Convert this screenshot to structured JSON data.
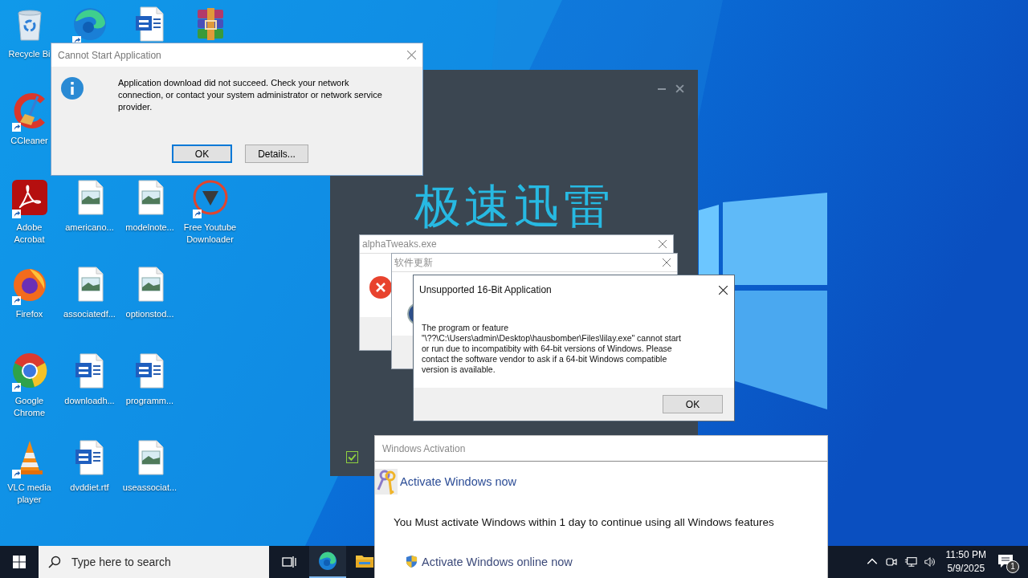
{
  "desktop_icons": [
    [
      {
        "kind": "recycle",
        "label": "Recycle Bi",
        "shortcut": false
      },
      {
        "kind": "edge",
        "shortcut": true
      },
      {
        "kind": "word",
        "shortcut": false
      },
      {
        "kind": "winrar",
        "shortcut": false
      }
    ],
    [
      {
        "kind": "ccleaner",
        "label": "CCleaner",
        "shortcut": true
      }
    ],
    [
      {
        "kind": "acrobat",
        "label": "Adobe Acrobat",
        "shortcut": true
      },
      {
        "kind": "image",
        "label": "americano...",
        "shortcut": false
      },
      {
        "kind": "image",
        "label": "modelnote...",
        "shortcut": false
      },
      {
        "kind": "ytdownloader",
        "label": "Free Youtube Downloader",
        "shortcut": true
      }
    ],
    [
      {
        "kind": "firefox",
        "label": "Firefox",
        "shortcut": true
      },
      {
        "kind": "image",
        "label": "associatedf...",
        "shortcut": false
      },
      {
        "kind": "image",
        "label": "optionstod...",
        "shortcut": false
      }
    ],
    [
      {
        "kind": "chrome",
        "label": "Google Chrome",
        "shortcut": true
      },
      {
        "kind": "word",
        "label": "downloadh...",
        "shortcut": false
      },
      {
        "kind": "word",
        "label": "programm...",
        "shortcut": false
      }
    ],
    [
      {
        "kind": "vlc",
        "label": "VLC media player",
        "shortcut": true
      },
      {
        "kind": "word",
        "label": "dvddiet.rtf",
        "shortcut": false
      },
      {
        "kind": "image",
        "label": "useassociat...",
        "shortcut": false
      }
    ]
  ],
  "xunlei_window": {
    "logo_text": "极速迅雷",
    "checkbox": {
      "checked": true
    }
  },
  "alpha_dialog": {
    "title": "alphaTweaks.exe"
  },
  "update_dialog": {
    "title": "软件更新"
  },
  "unsupported_dialog": {
    "title": "Unsupported 16-Bit Application",
    "message_lines": [
      "The program or feature",
      "\"\\??\\C:\\Users\\admin\\Desktop\\hausbomber\\Files\\lilay.exe\" cannot start",
      "or run due to incompatibity with 64-bit versions of Windows. Please",
      "contact the software vendor to ask if a 64-bit Windows compatible",
      "version is available."
    ],
    "buttons": [
      {
        "label": "OK",
        "focused": false
      }
    ]
  },
  "cannot_start_dialog": {
    "title": "Cannot Start Application",
    "message_lines": [
      "Application download did not succeed. Check your network",
      "connection, or contact your system administrator or network service",
      "provider."
    ],
    "buttons": [
      {
        "label": "OK",
        "focused": true
      },
      {
        "label": "Details...",
        "focused": false
      }
    ]
  },
  "activation_window": {
    "title": "Windows Activation",
    "heading": "Activate Windows now",
    "message": "You Must activate Windows within 1 day to continue using all Windows features",
    "link": "Activate Windows online now"
  },
  "taskbar": {
    "search": {
      "placeholder": "Type here to search"
    },
    "apps": [
      {
        "kind": "edge",
        "running": true
      },
      {
        "kind": "folder",
        "running": false
      }
    ],
    "tray": {
      "time": "11:50 PM",
      "date": "5/9/2025",
      "notification_count": "1"
    }
  }
}
